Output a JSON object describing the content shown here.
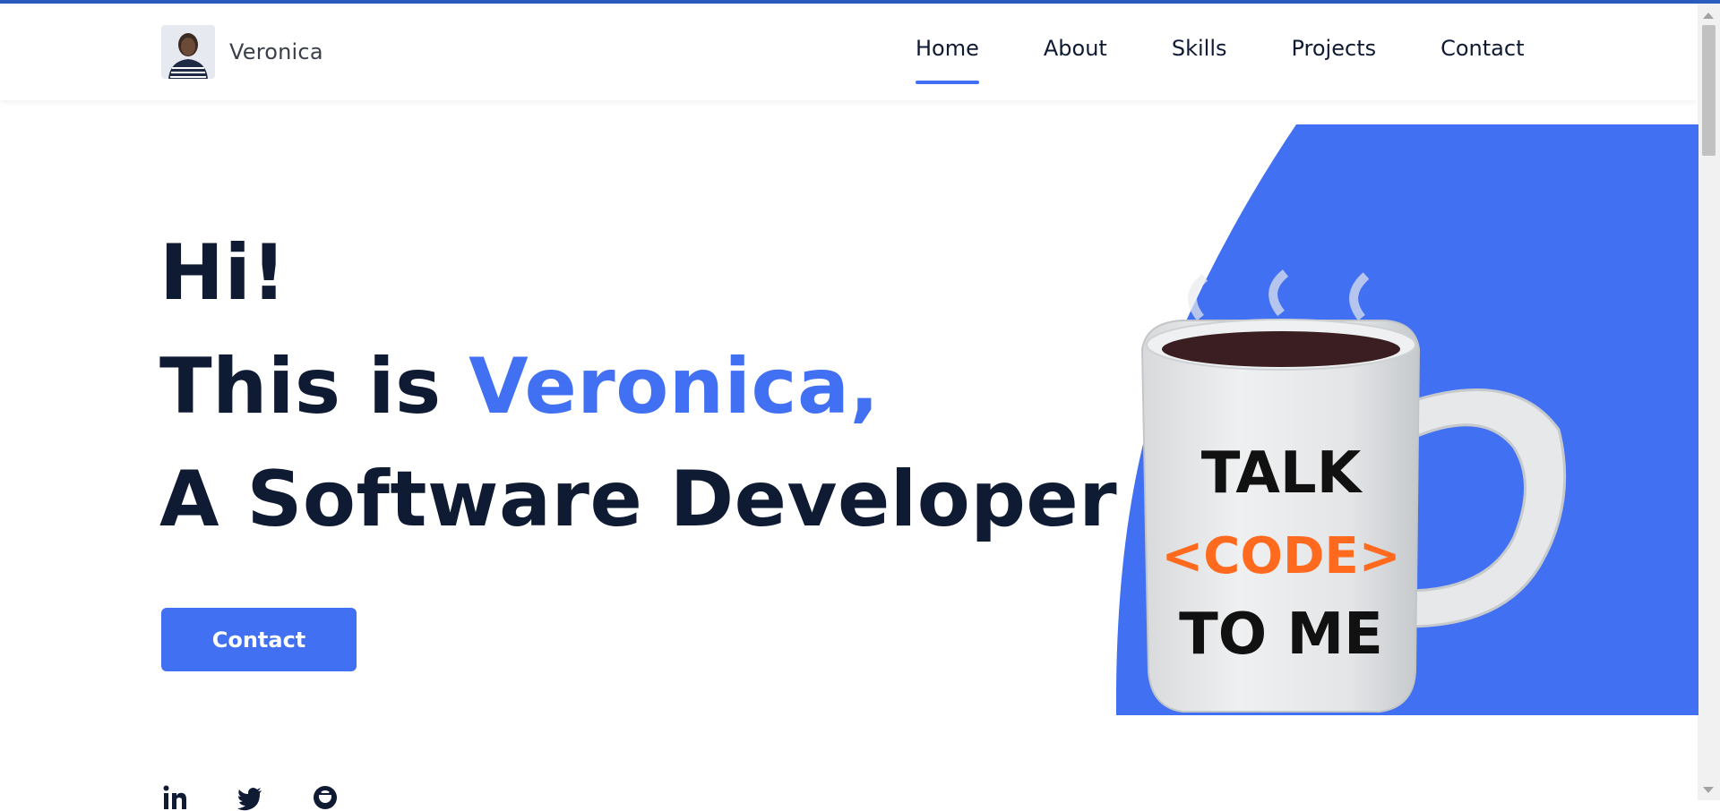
{
  "brand": {
    "name": "Veronica"
  },
  "nav": {
    "items": [
      {
        "label": "Home",
        "active": true
      },
      {
        "label": "About",
        "active": false
      },
      {
        "label": "Skills",
        "active": false
      },
      {
        "label": "Projects",
        "active": false
      },
      {
        "label": "Contact",
        "active": false
      }
    ]
  },
  "hero": {
    "greeting": "Hi!",
    "intro_prefix": "This is ",
    "name": "Veronica,",
    "role": "A Software Developer",
    "cta_label": "Contact"
  },
  "mug": {
    "line1": "TALK",
    "line2": "<CODE>",
    "line3": "TO ME"
  },
  "social": {
    "icons": [
      "linkedin-icon",
      "twitter-icon",
      "github-icon"
    ]
  },
  "colors": {
    "accent": "#4170f2",
    "text": "#0f1a33",
    "mug_orange": "#ff6a1f"
  }
}
